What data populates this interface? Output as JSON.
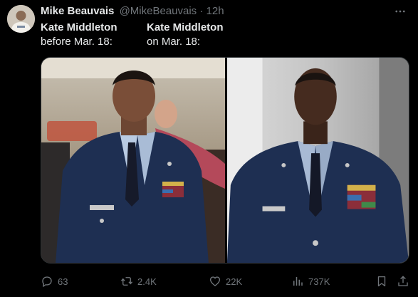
{
  "tweet": {
    "display_name": "Mike Beauvais",
    "handle": "@MikeBeauvais",
    "separator": "·",
    "time": "12h",
    "more_icon": "more-dots-icon",
    "text_left": {
      "line1": "Kate Middleton",
      "line2": "before Mar. 18:"
    },
    "text_right": {
      "line1": "Kate Middleton",
      "line2": "on Mar. 18:"
    }
  },
  "actions": {
    "reply": {
      "icon": "reply-icon",
      "count": "63"
    },
    "retweet": {
      "icon": "retweet-icon",
      "count": "2.4K"
    },
    "like": {
      "icon": "heart-icon",
      "count": "22K"
    },
    "views": {
      "icon": "views-icon",
      "count": "737K"
    },
    "bookmark": {
      "icon": "bookmark-icon"
    },
    "share": {
      "icon": "share-icon"
    }
  },
  "colors": {
    "background": "#000000",
    "primary_text": "#e7e9ea",
    "secondary_text": "#71767b",
    "border": "#2f3336",
    "uniform_blue": "#1e2f52"
  }
}
